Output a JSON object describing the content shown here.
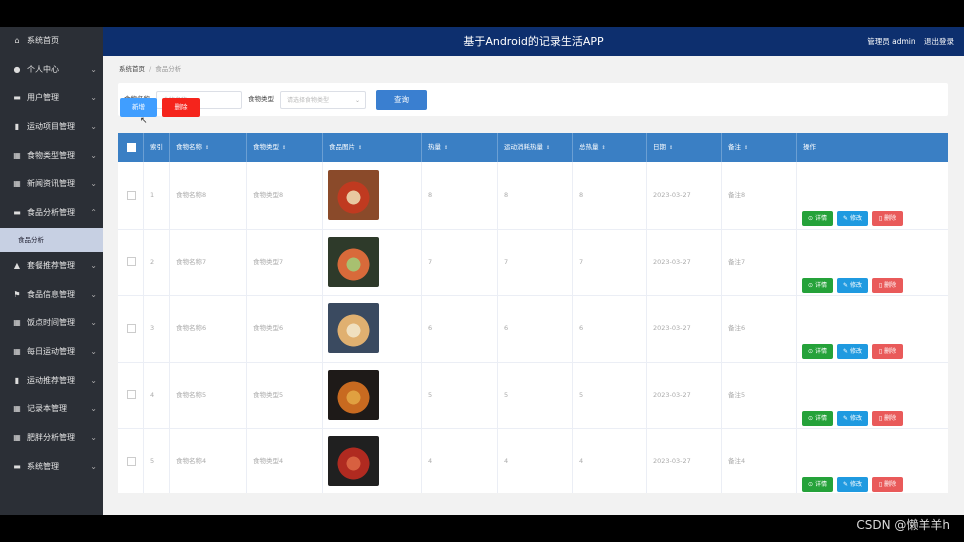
{
  "header": {
    "title": "基于Android的记录生活APP",
    "user": "管理员 admin",
    "logout": "退出登录"
  },
  "sidebar": {
    "items": [
      {
        "label": "系统首页",
        "icon": "home-icon",
        "glyph": "⌂",
        "chev": ""
      },
      {
        "label": "个人中心",
        "icon": "user-icon",
        "glyph": "●",
        "chev": "⌄"
      },
      {
        "label": "用户管理",
        "icon": "users-icon",
        "glyph": "▬",
        "chev": "⌄"
      },
      {
        "label": "运动项目管理",
        "icon": "clipboard-icon",
        "glyph": "▮",
        "chev": "⌄"
      },
      {
        "label": "食物类型管理",
        "icon": "grid-icon",
        "glyph": "▦",
        "chev": "⌄"
      },
      {
        "label": "新闻资讯管理",
        "icon": "grid-icon",
        "glyph": "▦",
        "chev": "⌄"
      },
      {
        "label": "食品分析管理",
        "icon": "monitor-icon",
        "glyph": "▬",
        "chev": "⌃"
      }
    ],
    "sub_item": "食品分析",
    "items2": [
      {
        "label": "套餐推荐管理",
        "icon": "chart-icon",
        "glyph": "▲",
        "chev": "⌄"
      },
      {
        "label": "食品信息管理",
        "icon": "flag-icon",
        "glyph": "⚑",
        "chev": "⌄"
      },
      {
        "label": "饭点时间管理",
        "icon": "grid-icon",
        "glyph": "▦",
        "chev": "⌄"
      },
      {
        "label": "每日运动管理",
        "icon": "table-icon",
        "glyph": "▦",
        "chev": "⌄"
      },
      {
        "label": "运动推荐管理",
        "icon": "clipboard-icon",
        "glyph": "▮",
        "chev": "⌄"
      },
      {
        "label": "记录本管理",
        "icon": "grid-icon",
        "glyph": "▦",
        "chev": "⌄"
      },
      {
        "label": "肥胖分析管理",
        "icon": "grid-icon",
        "glyph": "▦",
        "chev": "⌄"
      },
      {
        "label": "系统管理",
        "icon": "monitor-icon",
        "glyph": "▬",
        "chev": "⌄"
      }
    ]
  },
  "breadcrumb": {
    "home": "系统首页",
    "current": "食品分析"
  },
  "search": {
    "name_label": "食物名称",
    "name_placeholder": "食物名称",
    "type_label": "食物类型",
    "type_placeholder": "请选择食物类型",
    "query": "查询"
  },
  "actions": {
    "add": "新增",
    "delete": "删除"
  },
  "table": {
    "columns": [
      "索引",
      "食物名称",
      "食物类型",
      "食品图片",
      "热量",
      "运动消耗热量",
      "总热量",
      "日期",
      "备注",
      "操作"
    ],
    "rows": [
      {
        "idx": "1",
        "name": "食物名称8",
        "type": "食物类型8",
        "heat": "8",
        "burn": "8",
        "total": "8",
        "date": "2023-03-27",
        "note": "备注8"
      },
      {
        "idx": "2",
        "name": "食物名称7",
        "type": "食物类型7",
        "heat": "7",
        "burn": "7",
        "total": "7",
        "date": "2023-03-27",
        "note": "备注7"
      },
      {
        "idx": "3",
        "name": "食物名称6",
        "type": "食物类型6",
        "heat": "6",
        "burn": "6",
        "total": "6",
        "date": "2023-03-27",
        "note": "备注6"
      },
      {
        "idx": "4",
        "name": "食物名称5",
        "type": "食物类型5",
        "heat": "5",
        "burn": "5",
        "total": "5",
        "date": "2023-03-27",
        "note": "备注5"
      },
      {
        "idx": "5",
        "name": "食物名称4",
        "type": "食物类型4",
        "heat": "4",
        "burn": "4",
        "total": "4",
        "date": "2023-03-27",
        "note": "备注4"
      }
    ],
    "op_detail": "详情",
    "op_edit": "修改",
    "op_delete": "删除"
  },
  "watermark": "CSDN @懒羊羊h",
  "colors": {
    "header": "#0d2f6e",
    "sidebar": "#2b2f36",
    "table_head": "#3a7fc4",
    "detail": "#25a23a",
    "edit": "#1f9ae0",
    "remove": "#e95a5a"
  }
}
